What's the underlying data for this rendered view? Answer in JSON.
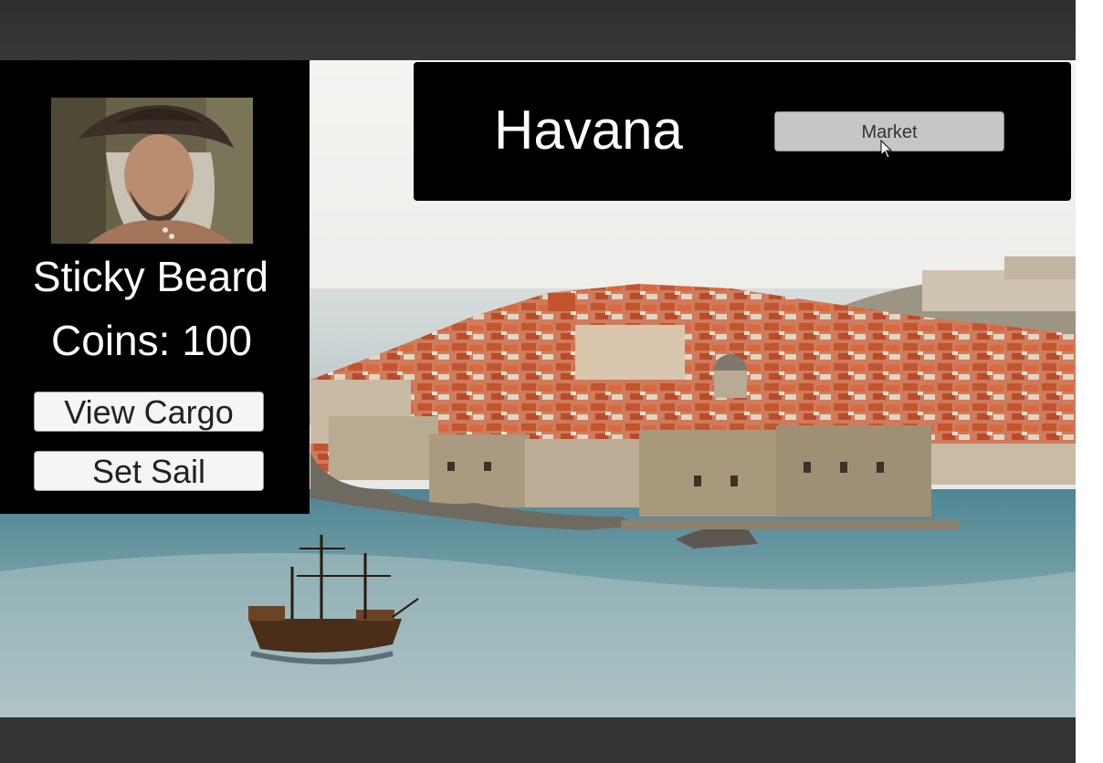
{
  "player": {
    "name": "Sticky Beard",
    "coins_text": "Coins: 100",
    "coins": 100,
    "portrait_icon": "pirate-portrait"
  },
  "actions": {
    "view_cargo_label": "View Cargo",
    "set_sail_label": "Set Sail"
  },
  "location": {
    "name": "Havana",
    "market_label": "Market"
  },
  "colors": {
    "panel": "#000000",
    "text": "#ffffff",
    "button": "#f5f5f5",
    "market_button": "#c6c6c6",
    "frame": "#333333",
    "sea": "#3f7481",
    "roofs": "#c2552e"
  }
}
